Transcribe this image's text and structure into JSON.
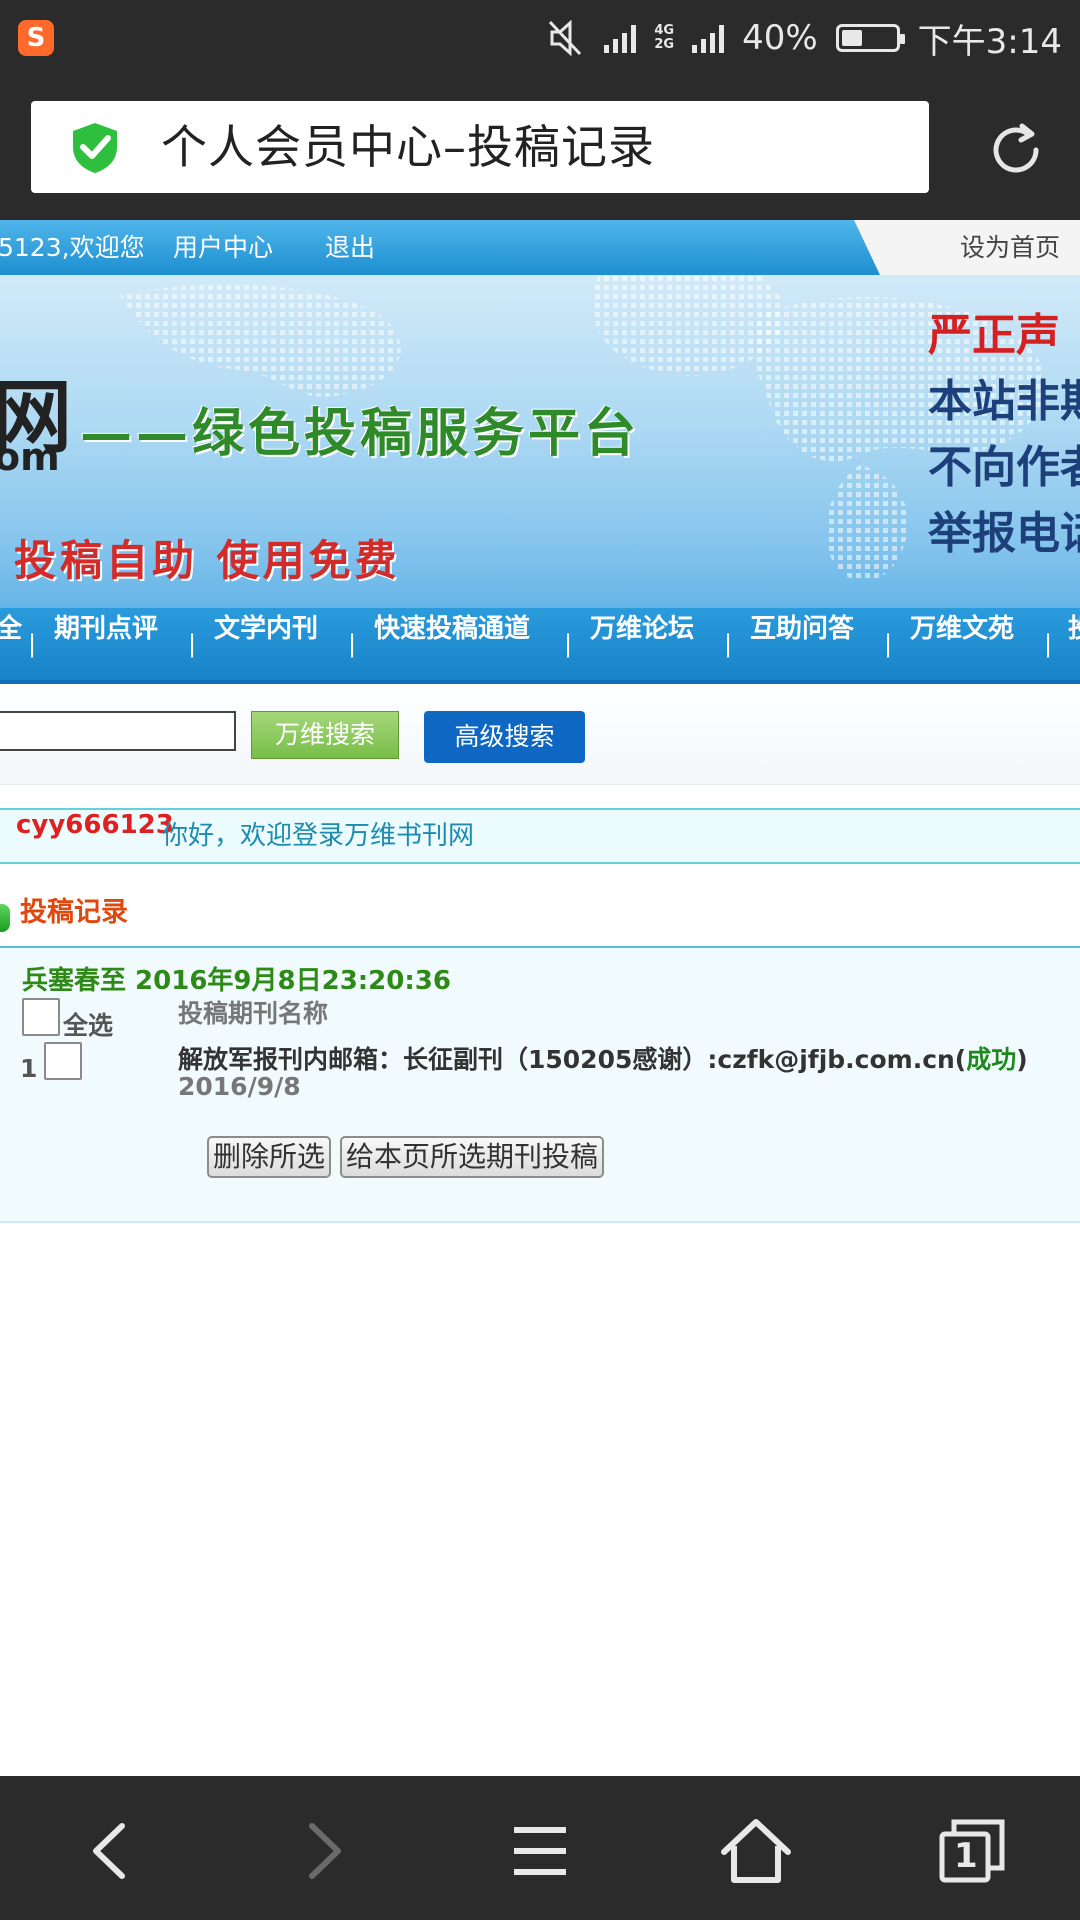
{
  "status_bar": {
    "app_icon_letter": "S",
    "network": "4G",
    "network2": "2G",
    "battery": "40%",
    "battery_level": 0.4,
    "time": "下午3:14"
  },
  "browser": {
    "page_title": "个人会员中心–投稿记录",
    "security_icon": "shield-check-icon",
    "reload_icon": "reload-icon"
  },
  "top_links": {
    "welcome": "5123,欢迎您",
    "user_center": "用户中心",
    "logout": "退出",
    "set_home": "设为首页"
  },
  "banner": {
    "logo_char": "网",
    "logo_domain": "om",
    "slogan": "——绿色投稿服务平台",
    "free_text": "投稿自助 使用免费",
    "notice_lines": [
      "严正声",
      "本站非期",
      "不向作者",
      "举报电话"
    ]
  },
  "nav": {
    "items": [
      "全",
      "期刊点评",
      "文学内刊",
      "快速投稿通道",
      "万维论坛",
      "互助问答",
      "万维文苑",
      "投"
    ]
  },
  "search": {
    "input_value": "",
    "search_button": "万维搜索",
    "advanced_button": "高级搜索"
  },
  "welcome": {
    "username": "cyy666123",
    "message": "你好，欢迎登录万维书刊网"
  },
  "section": {
    "title": "投稿记录"
  },
  "record": {
    "heading": "兵塞春至 2016年9月8日23:20:36",
    "select_all_label": "全选",
    "column_header": "投稿期刊名称",
    "rows": [
      {
        "index": "1",
        "journal_prefix": "解放军报刊内邮箱：长征副刊（150205感谢）:czfk@jfjb.com.cn(",
        "status": "成功",
        "journal_suffix": ")",
        "date": "2016/9/8"
      }
    ],
    "delete_button": "删除所选",
    "submit_button": "给本页所选期刊投稿"
  },
  "bottom_bar": {
    "icons": [
      "back-icon",
      "forward-icon",
      "menu-icon",
      "home-icon",
      "tabs-icon"
    ],
    "tab_count": "1"
  },
  "colors": {
    "chrome_bg": "#2b2b2b",
    "nav_blue": "#1883c8",
    "success_green": "#1e8a1e",
    "username_red": "#e02020",
    "section_orange": "#e0480e"
  }
}
